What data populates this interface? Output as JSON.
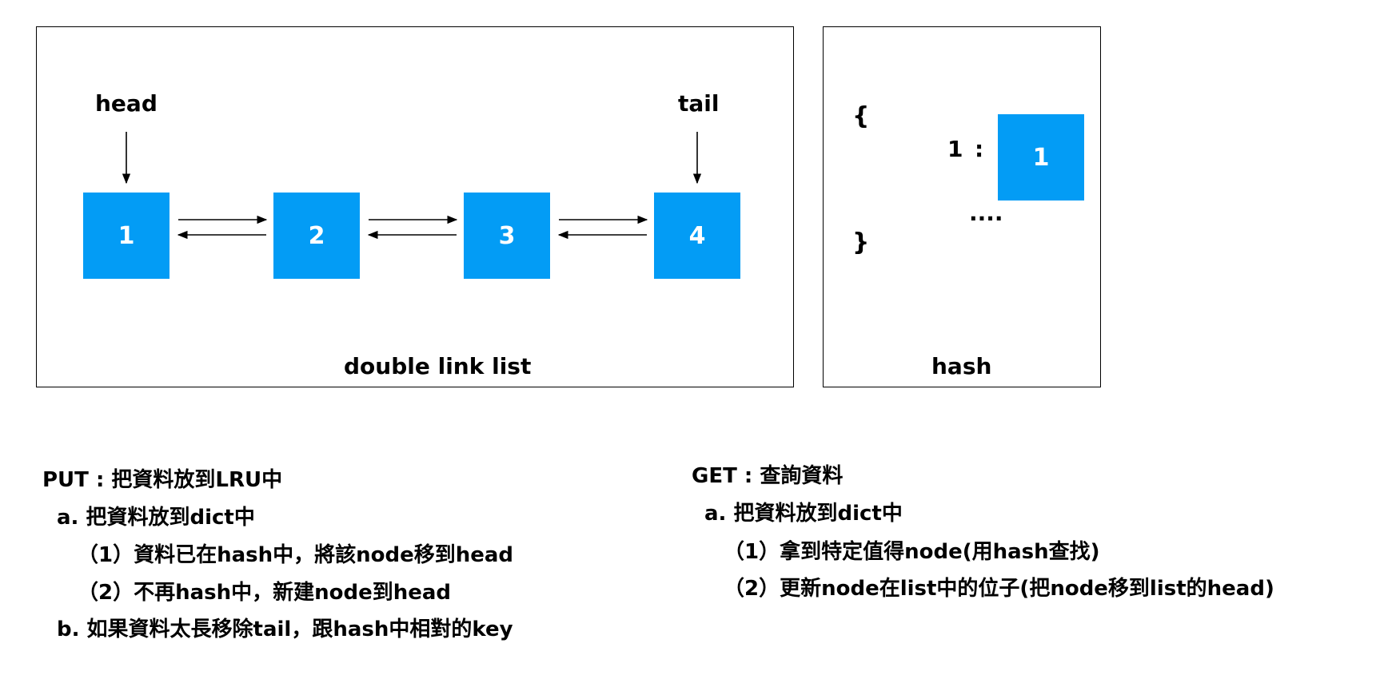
{
  "diagram": {
    "list_panel": {
      "caption": "double link list",
      "head_label": "head",
      "tail_label": "tail",
      "nodes": [
        "1",
        "2",
        "3",
        "4"
      ]
    },
    "hash_panel": {
      "caption": "hash",
      "open_brace": "{",
      "close_brace": "}",
      "key": "1",
      "separator": ":",
      "value_node": "1",
      "ellipsis": "...."
    },
    "colors": {
      "node_fill": "#039cf5",
      "node_text": "#ffffff",
      "stroke": "#000000"
    }
  },
  "notes": {
    "put": {
      "title": "PUT : 把資料放到LRU中",
      "item_a": "a. 把資料放到dict中",
      "item_a_1": "（1）資料已在hash中，將該node移到head",
      "item_a_2": "（2）不再hash中，新建node到head",
      "item_b": "b. 如果資料太長移除tail，跟hash中相對的key"
    },
    "get": {
      "title": "GET : 查詢資料",
      "item_a": "a. 把資料放到dict中",
      "item_a_1": "（1）拿到特定值得node(用hash查找)",
      "item_a_2": "（2）更新node在list中的位子(把node移到list的head)"
    }
  }
}
